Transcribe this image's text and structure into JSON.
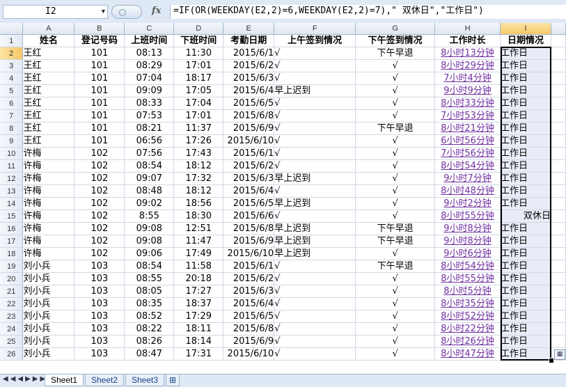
{
  "formula_bar": {
    "name_box": "I2",
    "fx_label": "fx",
    "formula": "=IF(OR(WEEKDAY(E2,2)=6,WEEKDAY(E2,2)=7),\"  双休日\",\"工作日\")"
  },
  "columns": [
    "A",
    "B",
    "C",
    "D",
    "E",
    "F",
    "G",
    "H",
    "I"
  ],
  "headers": [
    "姓名",
    "登记号码",
    "上班时间",
    "下班时间",
    "考勤日期",
    "上午签到情况",
    "下午签到情况",
    "工作时长",
    "日期情况"
  ],
  "rows": [
    {
      "n": "2",
      "name": "王红",
      "id": "101",
      "in": "08:13",
      "out": "11:30",
      "date": "2015/6/1",
      "am": "√",
      "pm": "下午早退",
      "dur": "8小时13分钟",
      "day": "工作日"
    },
    {
      "n": "3",
      "name": "王红",
      "id": "101",
      "in": "08:29",
      "out": "17:01",
      "date": "2015/6/2",
      "am": "√",
      "pm": "√",
      "dur": "8小时29分钟",
      "day": "工作日"
    },
    {
      "n": "4",
      "name": "王红",
      "id": "101",
      "in": "07:04",
      "out": "18:17",
      "date": "2015/6/3",
      "am": "√",
      "pm": "√",
      "dur": "7小时4分钟",
      "day": "工作日"
    },
    {
      "n": "5",
      "name": "王红",
      "id": "101",
      "in": "09:09",
      "out": "17:05",
      "date": "2015/6/4",
      "am": "早上迟到",
      "pm": "√",
      "dur": "9小时9分钟",
      "day": "工作日"
    },
    {
      "n": "6",
      "name": "王红",
      "id": "101",
      "in": "08:33",
      "out": "17:04",
      "date": "2015/6/5",
      "am": "√",
      "pm": "√",
      "dur": "8小时33分钟",
      "day": "工作日"
    },
    {
      "n": "7",
      "name": "王红",
      "id": "101",
      "in": "07:53",
      "out": "17:01",
      "date": "2015/6/8",
      "am": "√",
      "pm": "√",
      "dur": "7小时53分钟",
      "day": "工作日"
    },
    {
      "n": "8",
      "name": "王红",
      "id": "101",
      "in": "08:21",
      "out": "11:37",
      "date": "2015/6/9",
      "am": "√",
      "pm": "下午早退",
      "dur": "8小时21分钟",
      "day": "工作日"
    },
    {
      "n": "9",
      "name": "王红",
      "id": "101",
      "in": "06:56",
      "out": "17:26",
      "date": "2015/6/10",
      "am": "√",
      "pm": "√",
      "dur": "6小时56分钟",
      "day": "工作日"
    },
    {
      "n": "10",
      "name": "许梅",
      "id": "102",
      "in": "07:56",
      "out": "17:43",
      "date": "2015/6/1",
      "am": "√",
      "pm": "√",
      "dur": "7小时56分钟",
      "day": "工作日"
    },
    {
      "n": "11",
      "name": "许梅",
      "id": "102",
      "in": "08:54",
      "out": "18:12",
      "date": "2015/6/2",
      "am": "√",
      "pm": "√",
      "dur": "8小时54分钟",
      "day": "工作日"
    },
    {
      "n": "12",
      "name": "许梅",
      "id": "102",
      "in": "09:07",
      "out": "17:32",
      "date": "2015/6/3",
      "am": "早上迟到",
      "pm": "√",
      "dur": "9小时7分钟",
      "day": "工作日"
    },
    {
      "n": "13",
      "name": "许梅",
      "id": "102",
      "in": "08:48",
      "out": "18:12",
      "date": "2015/6/4",
      "am": "√",
      "pm": "√",
      "dur": "8小时48分钟",
      "day": "工作日"
    },
    {
      "n": "14",
      "name": "许梅",
      "id": "102",
      "in": "09:02",
      "out": "18:56",
      "date": "2015/6/5",
      "am": "早上迟到",
      "pm": "√",
      "dur": "9小时2分钟",
      "day": "工作日"
    },
    {
      "n": "15",
      "name": "许梅",
      "id": "102",
      "in": "8:55",
      "out": "18:30",
      "date": "2015/6/6",
      "am": "√",
      "pm": "√",
      "dur": "8小时55分钟",
      "day": "双休日"
    },
    {
      "n": "16",
      "name": "许梅",
      "id": "102",
      "in": "09:08",
      "out": "12:51",
      "date": "2015/6/8",
      "am": "早上迟到",
      "pm": "下午早退",
      "dur": "9小时8分钟",
      "day": "工作日"
    },
    {
      "n": "17",
      "name": "许梅",
      "id": "102",
      "in": "09:08",
      "out": "11:47",
      "date": "2015/6/9",
      "am": "早上迟到",
      "pm": "下午早退",
      "dur": "9小时8分钟",
      "day": "工作日"
    },
    {
      "n": "18",
      "name": "许梅",
      "id": "102",
      "in": "09:06",
      "out": "17:49",
      "date": "2015/6/10",
      "am": "早上迟到",
      "pm": "√",
      "dur": "9小时6分钟",
      "day": "工作日"
    },
    {
      "n": "19",
      "name": "刘小兵",
      "id": "103",
      "in": "08:54",
      "out": "11:58",
      "date": "2015/6/1",
      "am": "√",
      "pm": "下午早退",
      "dur": "8小时54分钟",
      "day": "工作日"
    },
    {
      "n": "20",
      "name": "刘小兵",
      "id": "103",
      "in": "08:55",
      "out": "20:18",
      "date": "2015/6/2",
      "am": "√",
      "pm": "√",
      "dur": "8小时55分钟",
      "day": "工作日"
    },
    {
      "n": "21",
      "name": "刘小兵",
      "id": "103",
      "in": "08:05",
      "out": "17:27",
      "date": "2015/6/3",
      "am": "√",
      "pm": "√",
      "dur": "8小时5分钟",
      "day": "工作日"
    },
    {
      "n": "22",
      "name": "刘小兵",
      "id": "103",
      "in": "08:35",
      "out": "18:37",
      "date": "2015/6/4",
      "am": "√",
      "pm": "√",
      "dur": "8小时35分钟",
      "day": "工作日"
    },
    {
      "n": "23",
      "name": "刘小兵",
      "id": "103",
      "in": "08:52",
      "out": "17:29",
      "date": "2015/6/5",
      "am": "√",
      "pm": "√",
      "dur": "8小时52分钟",
      "day": "工作日"
    },
    {
      "n": "24",
      "name": "刘小兵",
      "id": "103",
      "in": "08:22",
      "out": "18:11",
      "date": "2015/6/8",
      "am": "√",
      "pm": "√",
      "dur": "8小时22分钟",
      "day": "工作日"
    },
    {
      "n": "25",
      "name": "刘小兵",
      "id": "103",
      "in": "08:26",
      "out": "18:14",
      "date": "2015/6/9",
      "am": "√",
      "pm": "√",
      "dur": "8小时26分钟",
      "day": "工作日"
    },
    {
      "n": "26",
      "name": "刘小兵",
      "id": "103",
      "in": "08:47",
      "out": "17:31",
      "date": "2015/6/10",
      "am": "√",
      "pm": "√",
      "dur": "8小时47分钟",
      "day": "工作日"
    }
  ],
  "sheet_tabs": [
    "Sheet1",
    "Sheet2",
    "Sheet3"
  ],
  "colors": {
    "link": "#7030a0",
    "selection_header": "#f7c766",
    "header_bg": "#dfe6f0"
  }
}
